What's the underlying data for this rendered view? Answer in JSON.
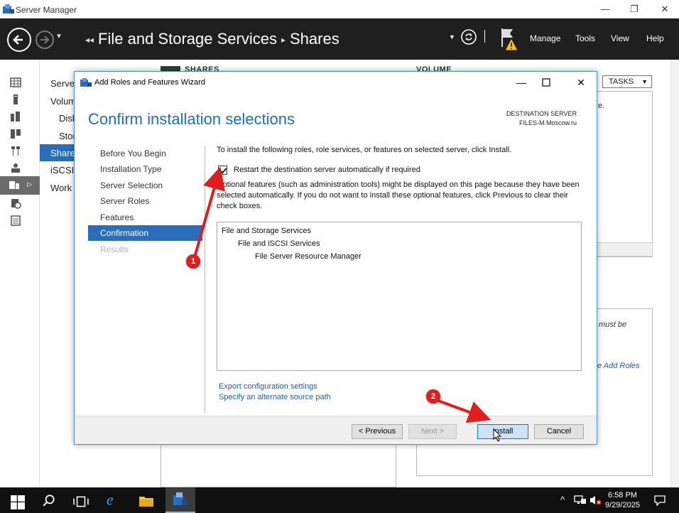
{
  "window": {
    "app_title": "Server Manager",
    "minimize_glyph": "—",
    "restore_glyph": "❐",
    "close_glyph": "✕"
  },
  "header": {
    "breadcrumb_prefix": "◂◂",
    "breadcrumb_section": "File and Storage Services",
    "breadcrumb_separator": "▸",
    "breadcrumb_page": "Shares",
    "menu": [
      "Manage",
      "Tools",
      "View",
      "Help"
    ]
  },
  "subnav": {
    "items": [
      "Servers",
      "Volumes",
      "Disks",
      "Storage Pools",
      "Shares",
      "iSCSI",
      "Work Folders"
    ]
  },
  "background": {
    "shares_header": "SHARES",
    "volume_header": "VOLUME",
    "tasks_label": "TASKS",
    "right_text_1": "e.",
    "right_text_2": "must be",
    "right_link": "e Add Roles"
  },
  "wizard": {
    "title": "Add Roles and Features Wizard",
    "heading": "Confirm installation selections",
    "destination_label": "DESTINATION SERVER",
    "destination_server": "FILES-M.Moscow.ru",
    "steps": [
      {
        "label": "Before You Begin",
        "state": "normal"
      },
      {
        "label": "Installation Type",
        "state": "normal"
      },
      {
        "label": "Server Selection",
        "state": "normal"
      },
      {
        "label": "Server Roles",
        "state": "normal"
      },
      {
        "label": "Features",
        "state": "normal"
      },
      {
        "label": "Confirmation",
        "state": "active"
      },
      {
        "label": "Results",
        "state": "disabled"
      }
    ],
    "intro": "To install the following roles, role services, or features on selected server, click Install.",
    "restart_checkbox_label": "Restart the destination server automatically if required",
    "restart_checked": true,
    "optional_text": "Optional features (such as administration tools) might be displayed on this page because they have been selected automatically. If you do not want to install these optional features, click Previous to clear their check boxes.",
    "features": [
      {
        "label": "File and Storage Services",
        "level": 0
      },
      {
        "label": "File and iSCSI Services",
        "level": 1
      },
      {
        "label": "File Server Resource Manager",
        "level": 2
      }
    ],
    "export_link": "Export configuration settings",
    "alternate_source_link": "Specify an alternate source path",
    "buttons": {
      "previous": "< Previous",
      "next": "Next >",
      "install": "Install",
      "cancel": "Cancel"
    }
  },
  "annotations": {
    "marker_1": "1",
    "marker_2": "2",
    "color": "#e31d1d"
  },
  "taskbar": {
    "time": "6:58 PM",
    "date": "9/29/2025",
    "tray_chevron": "^"
  },
  "colors": {
    "accent": "#2a6ebb",
    "header_bg": "#1f1f1f",
    "link": "#1f5ea8",
    "heading": "#1d6fb8"
  }
}
